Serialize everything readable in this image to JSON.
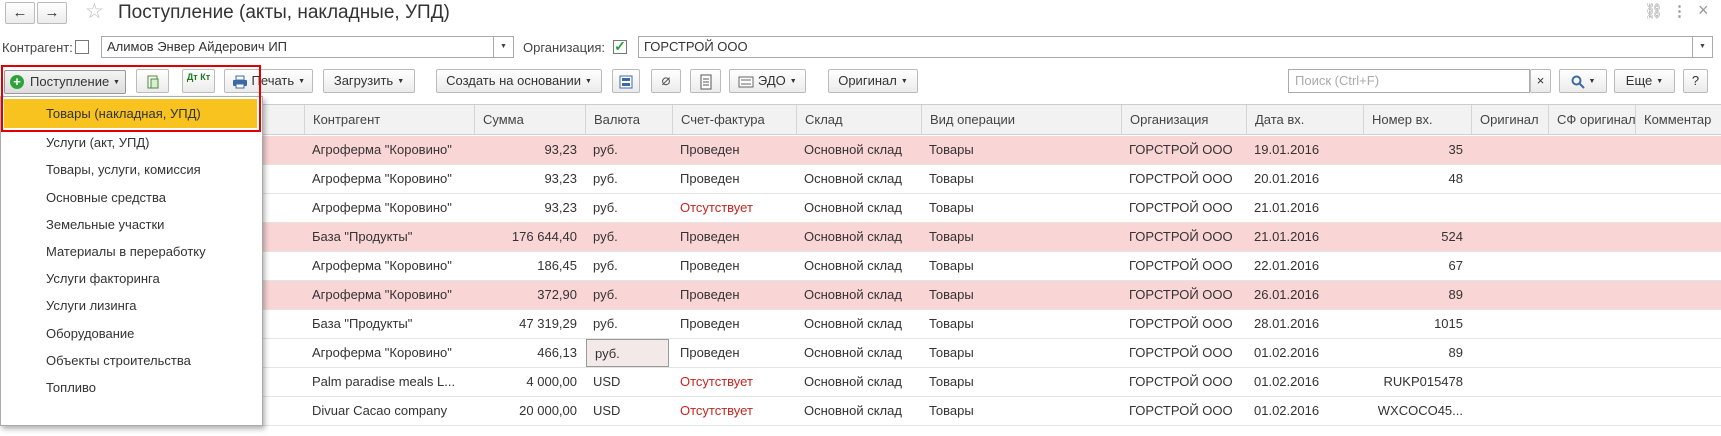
{
  "window": {
    "title": "Поступление (акты, накладные, УПД)",
    "back_icon": "←",
    "forward_icon": "→",
    "star_icon": "☆",
    "link_icon": "⛓",
    "more_icon": "⋮",
    "close_icon": "×"
  },
  "filters": {
    "counterparty_label": "Контрагент:",
    "counterparty_value": "Алимов Энвер Айдерович ИП",
    "organization_label": "Организация:",
    "organization_value": "ГОРСТРОЙ ООО",
    "organization_checked": true
  },
  "toolbar": {
    "post_label": "Поступление",
    "print_label": "Печать",
    "load_label": "Загрузить",
    "create_based_label": "Создать на основании",
    "edo_label": "ЭДО",
    "original_label": "Оригинал",
    "search_placeholder": "Поиск (Ctrl+F)",
    "search_clear": "×",
    "more_label": "Еще",
    "help_label": "?",
    "dtkt_label": "Дт Кт"
  },
  "columns": [
    "Контрагент",
    "Сумма",
    "Валюта",
    "Счет-фактура",
    "Склад",
    "Вид операции",
    "Организация",
    "Дата вх.",
    "Номер вх.",
    "Оригинал",
    "СФ оригинал",
    "Комментар"
  ],
  "rows": [
    {
      "counterparty": "Агроферма \"Коровино\"",
      "sum": "93,23",
      "currency": "руб.",
      "invoice": "Проведен",
      "warehouse": "Основной склад",
      "operation": "Товары",
      "org": "ГОРСТРОЙ ООО",
      "date": "19.01.2016",
      "number": "35"
    },
    {
      "counterparty": "Агроферма \"Коровино\"",
      "sum": "93,23",
      "currency": "руб.",
      "invoice": "Проведен",
      "warehouse": "Основной склад",
      "operation": "Товары",
      "org": "ГОРСТРОЙ ООО",
      "date": "20.01.2016",
      "number": "48"
    },
    {
      "counterparty": "Агроферма \"Коровино\"",
      "sum": "93,23",
      "currency": "руб.",
      "invoice": "Отсутствует",
      "warehouse": "Основной склад",
      "operation": "Товары",
      "org": "ГОРСТРОЙ ООО",
      "date": "21.01.2016",
      "number": ""
    },
    {
      "counterparty": "База \"Продукты\"",
      "sum": "176 644,40",
      "currency": "руб.",
      "invoice": "Проведен",
      "warehouse": "Основной склад",
      "operation": "Товары",
      "org": "ГОРСТРОЙ ООО",
      "date": "21.01.2016",
      "number": "524"
    },
    {
      "counterparty": "Агроферма \"Коровино\"",
      "sum": "186,45",
      "currency": "руб.",
      "invoice": "Проведен",
      "warehouse": "Основной склад",
      "operation": "Товары",
      "org": "ГОРСТРОЙ ООО",
      "date": "22.01.2016",
      "number": "67"
    },
    {
      "counterparty": "Агроферма \"Коровино\"",
      "sum": "372,90",
      "currency": "руб.",
      "invoice": "Проведен",
      "warehouse": "Основной склад",
      "operation": "Товары",
      "org": "ГОРСТРОЙ ООО",
      "date": "26.01.2016",
      "number": "89"
    },
    {
      "counterparty": "База \"Продукты\"",
      "sum": "47 319,29",
      "currency": "руб.",
      "invoice": "Проведен",
      "warehouse": "Основной склад",
      "operation": "Товары",
      "org": "ГОРСТРОЙ ООО",
      "date": "28.01.2016",
      "number": "1015"
    },
    {
      "counterparty": "Агроферма \"Коровино\"",
      "sum": "466,13",
      "currency": "руб.",
      "invoice": "Проведен",
      "warehouse": "Основной склад",
      "operation": "Товары",
      "org": "ГОРСТРОЙ ООО",
      "date": "01.02.2016",
      "number": "89"
    },
    {
      "counterparty": "Palm paradise meals L...",
      "sum": "4 000,00",
      "currency": "USD",
      "invoice": "Отсутствует",
      "warehouse": "Основной склад",
      "operation": "Товары",
      "org": "ГОРСТРОЙ ООО",
      "date": "01.02.2016",
      "number": "RUKP015478"
    },
    {
      "counterparty": "Divuar Cacao company",
      "sum": "20 000,00",
      "currency": "USD",
      "invoice": "Отсутствует",
      "warehouse": "Основной склад",
      "operation": "Товары",
      "org": "ГОРСТРОЙ ООО",
      "date": "01.02.2016",
      "number": "WXCOCO45..."
    }
  ],
  "menu": [
    "Товары (накладная, УПД)",
    "Услуги (акт, УПД)",
    "Товары, услуги, комиссия",
    "Основные средства",
    "Земельные участки",
    "Материалы в переработку",
    "Услуги факторинга",
    "Услуги лизинга",
    "Оборудование",
    "Объекты строительства",
    "Топливо"
  ],
  "colors": {
    "pink_row": "#fad5d5",
    "menu_highlight": "#f8c21f",
    "red_text": "#c8241d",
    "callout": "#e00000"
  }
}
